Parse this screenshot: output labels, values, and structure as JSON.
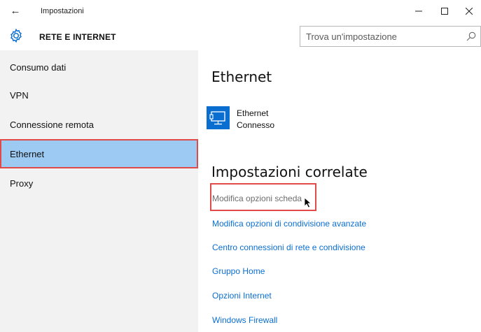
{
  "window": {
    "title": "Impostazioni",
    "controls": [
      "minimize",
      "maximize",
      "close"
    ]
  },
  "header": {
    "section_title": "RETE E INTERNET",
    "search_placeholder": "Trova un'impostazione"
  },
  "sidebar": {
    "items": [
      {
        "label": "Consumo dati",
        "active": false
      },
      {
        "label": "VPN",
        "active": false
      },
      {
        "label": "Connessione remota",
        "active": false
      },
      {
        "label": "Ethernet",
        "active": true
      },
      {
        "label": "Proxy",
        "active": false
      }
    ]
  },
  "main": {
    "title": "Ethernet",
    "connection": {
      "name": "Ethernet",
      "status": "Connesso"
    },
    "related_title": "Impostazioni correlate",
    "links": [
      {
        "label": "Modifica opzioni scheda",
        "hovered": true
      },
      {
        "label": "Modifica opzioni di condivisione avanzate",
        "hovered": false
      },
      {
        "label": "Centro connessioni di rete e condivisione",
        "hovered": false
      },
      {
        "label": "Gruppo Home",
        "hovered": false
      },
      {
        "label": "Opzioni Internet",
        "hovered": false
      },
      {
        "label": "Windows Firewall",
        "hovered": false
      }
    ]
  },
  "colors": {
    "accent": "#0a6ed1",
    "selected_bg": "#9ccaf2",
    "highlight_border": "#e04a4a",
    "sidebar_bg": "#f2f2f2"
  },
  "icons": {
    "back": "arrow-left-icon",
    "settings": "gear-icon",
    "search": "search-icon",
    "connection": "ethernet-monitor-icon"
  }
}
